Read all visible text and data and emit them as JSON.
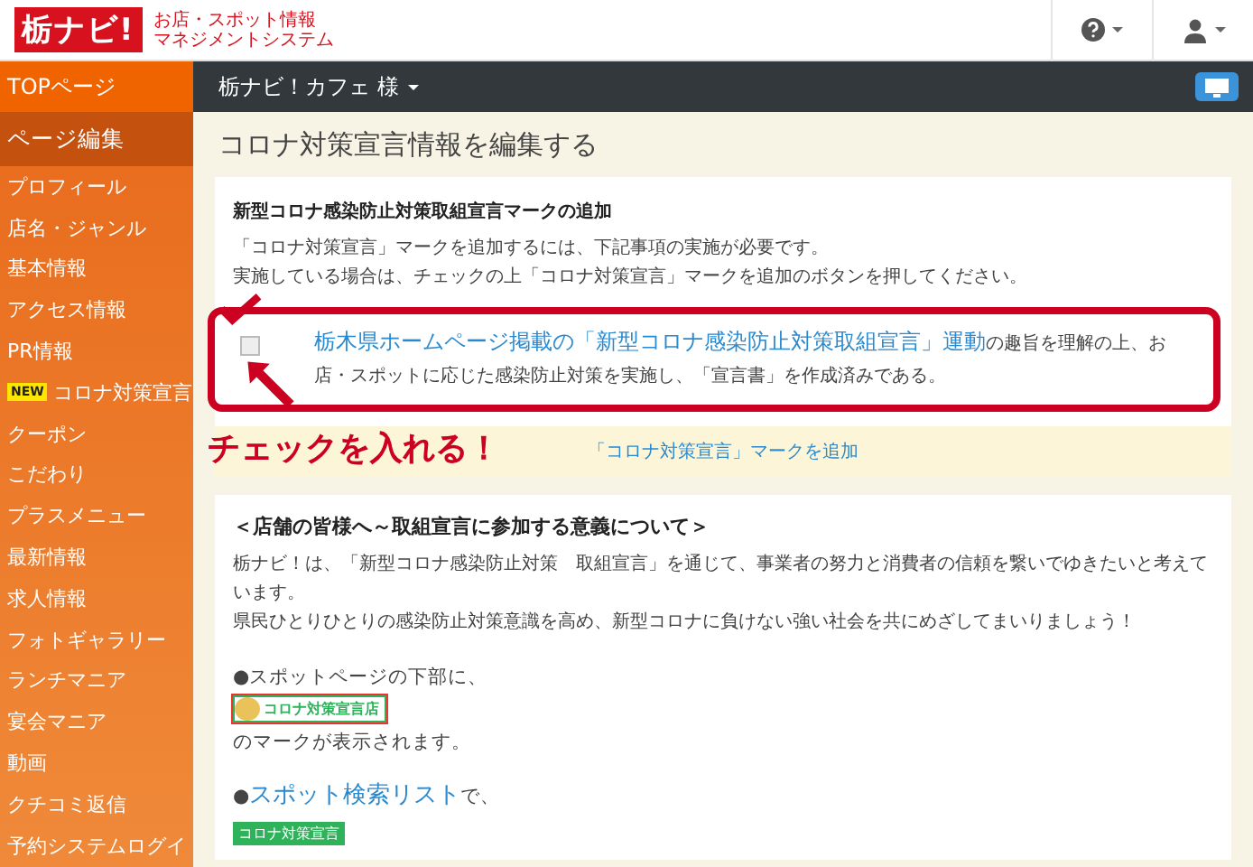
{
  "header": {
    "logo": "栃ナビ!",
    "subtitle": [
      "お店・スポット情報",
      "マネジメントシステム"
    ]
  },
  "sidebar": {
    "items": [
      {
        "label": "TOPページ",
        "selected": false,
        "kind": "top"
      },
      {
        "label": "ページ編集",
        "selected": true,
        "kind": "section"
      },
      {
        "label": "プロフィール",
        "selected": false,
        "kind": "item"
      },
      {
        "label": "店名・ジャンル",
        "selected": false,
        "kind": "item"
      },
      {
        "label": "基本情報",
        "selected": false,
        "kind": "item"
      },
      {
        "label": "アクセス情報",
        "selected": false,
        "kind": "item"
      },
      {
        "label": "PR情報",
        "selected": false,
        "kind": "item"
      },
      {
        "label": "コロナ対策宣言",
        "badge": "NEW",
        "selected": false,
        "kind": "item"
      },
      {
        "label": "クーポン",
        "selected": false,
        "kind": "item"
      },
      {
        "label": "こだわり",
        "selected": false,
        "kind": "item"
      },
      {
        "label": "プラスメニュー",
        "selected": false,
        "kind": "item"
      },
      {
        "label": "最新情報",
        "selected": false,
        "kind": "item"
      },
      {
        "label": "求人情報",
        "selected": false,
        "kind": "item"
      },
      {
        "label": "フォトギャラリー",
        "selected": false,
        "kind": "item"
      },
      {
        "label": "ランチマニア",
        "selected": false,
        "kind": "item"
      },
      {
        "label": "宴会マニア",
        "selected": false,
        "kind": "item"
      },
      {
        "label": "動画",
        "selected": false,
        "kind": "item"
      },
      {
        "label": "クチコミ返信",
        "selected": false,
        "kind": "item"
      },
      {
        "label": "予約システムログイ",
        "selected": false,
        "kind": "item"
      }
    ]
  },
  "topbar": {
    "account": "栃ナビ！カフェ 様"
  },
  "page_title": "コロナ対策宣言情報を編集する",
  "card1": {
    "heading": "新型コロナ感染防止対策取組宣言マークの追加",
    "lines": [
      "「コロナ対策宣言」マークを追加するには、下記事項の実施が必要です。",
      "実施している場合は、チェックの上「コロナ対策宣言」マークを追加のボタンを押してください。"
    ],
    "checkbox": {
      "checked": false,
      "link": "栃木県ホームページ掲載の「新型コロナ感染防止対策取組宣言」運動",
      "text": "の趣旨を理解の上、お店・スポットに応じた感染防止対策を実施し、「宣言書」を作成済みである。"
    },
    "add_button": "「コロナ対策宣言」マークを追加"
  },
  "annotation": {
    "callout": "チェックを入れる！"
  },
  "card2": {
    "heading": "＜店舗の皆様へ～取組宣言に参加する意義について＞",
    "paragraph": [
      "栃ナビ！は、「新型コロナ感染防止対策　取組宣言」を通じて、事業者の努力と消費者の信頼を繋いでゆきたいと考えています。",
      "県民ひとりひとりの感染防止対策意識を高め、新型コロナに負けない強い社会を共にめざしてまいりましょう！"
    ],
    "spot_page": {
      "bullet": "●",
      "text": "スポットページの下部に、",
      "badge": "コロナ対策宣言店",
      "after": "のマークが表示されます。"
    },
    "search_list": {
      "bullet": "●",
      "link": "スポット検索リスト",
      "text": "で、",
      "badge": "コロナ対策宣言"
    }
  }
}
